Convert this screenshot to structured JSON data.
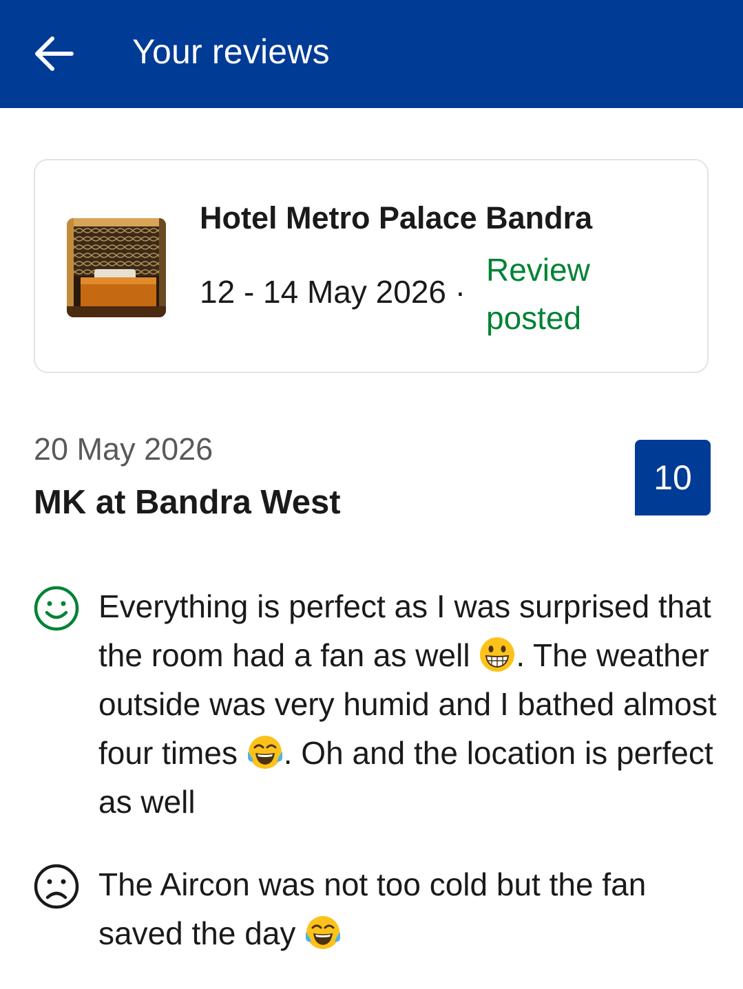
{
  "header": {
    "title": "Your reviews",
    "back_icon": "arrow-left-icon",
    "background_color": "#003b95"
  },
  "booking": {
    "hotel_name": "Hotel Metro Palace Bandra",
    "dates": "12 - 14 May 2026 ·",
    "status": "Review posted",
    "status_color": "#008234",
    "thumbnail_icon": "hotel-room-photo"
  },
  "review": {
    "date": "20 May 2026",
    "reviewer": "MK at Bandra West",
    "score": "10",
    "positive": {
      "icon": "smiley-face-icon",
      "segments": [
        "Everything is perfect as I was surprised that the room had a fan as well ",
        ". The weather outside was very humid and I bathed almost four times ",
        ". Oh and the location is perfect as well"
      ],
      "emojis": [
        "grinning-face-emoji",
        "tears-of-joy-emoji"
      ]
    },
    "negative": {
      "icon": "sad-face-icon",
      "segments": [
        "The Aircon was not too cold but the fan saved the day "
      ],
      "emojis": [
        "tears-of-joy-emoji"
      ]
    }
  }
}
